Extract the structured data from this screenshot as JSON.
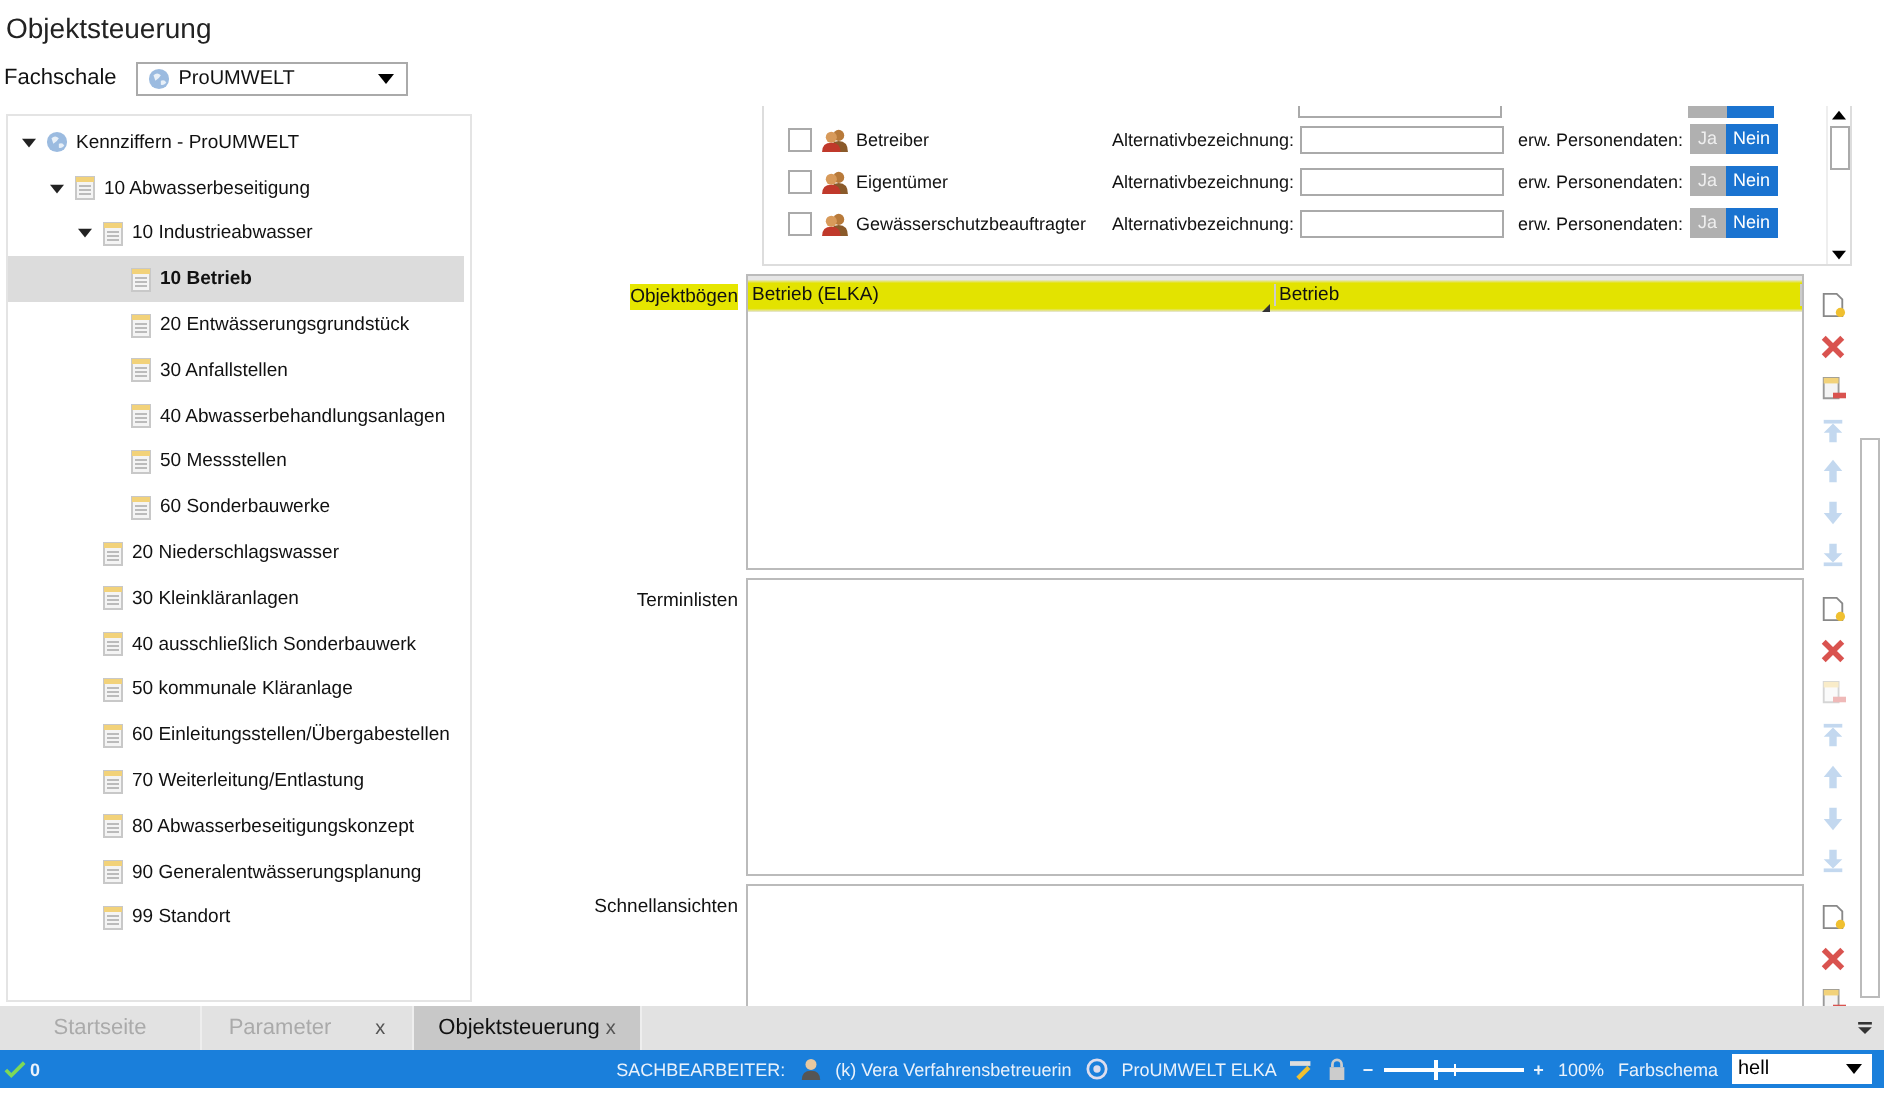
{
  "window": {
    "title": "Objektsteuerung"
  },
  "fachschale": {
    "label": "Fachschale",
    "value": "ProUMWELT"
  },
  "tree": [
    {
      "label": "Kennziffern - ProUMWELT",
      "kind": "root",
      "expanded": true,
      "selected": false,
      "children": [
        {
          "label": "10 Abwasserbeseitigung",
          "kind": "doc",
          "expanded": true,
          "selected": false,
          "children": [
            {
              "label": "10 Industrieabwasser",
              "kind": "doc",
              "expanded": true,
              "selected": false,
              "children": [
                {
                  "label": "10 Betrieb",
                  "kind": "doc",
                  "selected": true
                },
                {
                  "label": "20 Entwässerungsgrundstück",
                  "kind": "doc",
                  "selected": false
                },
                {
                  "label": "30 Anfallstellen",
                  "kind": "doc",
                  "selected": false
                },
                {
                  "label": "40 Abwasserbehandlungsanlagen",
                  "kind": "doc",
                  "selected": false
                },
                {
                  "label": "50 Messstellen",
                  "kind": "doc",
                  "selected": false
                },
                {
                  "label": "60 Sonderbauwerke",
                  "kind": "doc",
                  "selected": false
                }
              ]
            },
            {
              "label": "20 Niederschlagswasser",
              "kind": "doc",
              "selected": false
            },
            {
              "label": "30 Kleinkläranlagen",
              "kind": "doc",
              "selected": false
            },
            {
              "label": "40 ausschließlich Sonderbauwerk",
              "kind": "doc",
              "selected": false
            },
            {
              "label": "50 kommunale Kläranlage",
              "kind": "doc",
              "selected": false
            },
            {
              "label": "60 Einleitungsstellen/Übergabestellen",
              "kind": "doc",
              "selected": false
            },
            {
              "label": "70 Weiterleitung/Entlastung",
              "kind": "doc",
              "selected": false
            },
            {
              "label": "80 Abwasserbeseitigungskonzept",
              "kind": "doc",
              "selected": false
            },
            {
              "label": "90 Generalentwässerungsplanung",
              "kind": "doc",
              "selected": false
            },
            {
              "label": "99 Standort",
              "kind": "doc",
              "selected": false
            }
          ]
        }
      ]
    }
  ],
  "roles": [
    {
      "name": "Betreiber",
      "checked": false,
      "alt_label": "Alternativbezeichnung:",
      "ext_label": "erw. Personendaten:",
      "options": [
        {
          "label": "Ja",
          "selected": false
        },
        {
          "label": "Nein",
          "selected": true
        }
      ]
    },
    {
      "name": "Eigentümer",
      "checked": false,
      "alt_label": "Alternativbezeichnung:",
      "ext_label": "erw. Personendaten:",
      "options": [
        {
          "label": "Ja",
          "selected": false
        },
        {
          "label": "Nein",
          "selected": true
        }
      ]
    },
    {
      "name": "Gewässerschutzbeauftragter",
      "checked": false,
      "alt_label": "Alternativbezeichnung:",
      "ext_label": "erw. Personendaten:",
      "options": [
        {
          "label": "Ja",
          "selected": false
        },
        {
          "label": "Nein",
          "selected": true
        }
      ]
    }
  ],
  "sections": [
    {
      "label": "Objektbögen",
      "highlighted": true,
      "columns": [
        "Betrieb (ELKA)",
        "Betrieb"
      ],
      "tools": [
        {
          "kind": "new",
          "disabled": false
        },
        {
          "kind": "delete",
          "disabled": false
        },
        {
          "kind": "remove",
          "disabled": false
        },
        {
          "kind": "top",
          "disabled": true
        },
        {
          "kind": "up",
          "disabled": true
        },
        {
          "kind": "down",
          "disabled": true
        },
        {
          "kind": "bottom",
          "disabled": true
        }
      ]
    },
    {
      "label": "Terminlisten",
      "highlighted": false,
      "tools": [
        {
          "kind": "new",
          "disabled": false
        },
        {
          "kind": "delete",
          "disabled": false
        },
        {
          "kind": "remove",
          "disabled": true
        },
        {
          "kind": "top",
          "disabled": true
        },
        {
          "kind": "up",
          "disabled": true
        },
        {
          "kind": "down",
          "disabled": true
        },
        {
          "kind": "bottom",
          "disabled": true
        }
      ]
    },
    {
      "label": "Schnellansichten",
      "highlighted": false,
      "tools": [
        {
          "kind": "new",
          "disabled": false
        },
        {
          "kind": "delete",
          "disabled": false
        },
        {
          "kind": "remove",
          "disabled": false
        }
      ]
    }
  ],
  "tabs": [
    {
      "label": "Startseite",
      "selected": false,
      "closable": false
    },
    {
      "label": "Parameter",
      "selected": false,
      "closable": true,
      "close": "x"
    },
    {
      "label": "Objektsteuerung",
      "selected": true,
      "closable": true,
      "close": "x"
    }
  ],
  "status_bar": {
    "ok_count": "0",
    "user_label": "SACHBEARBEITER:",
    "user": "(k) Vera Verfahrensbetreuerin",
    "module": "ProUMWELT ELKA",
    "zoom_minus": "−",
    "zoom_plus": "+",
    "zoom": {
      "level": 0.37
    },
    "zoom_value": "100%",
    "scheme_label": "Farbschema",
    "scheme_value": "hell"
  }
}
